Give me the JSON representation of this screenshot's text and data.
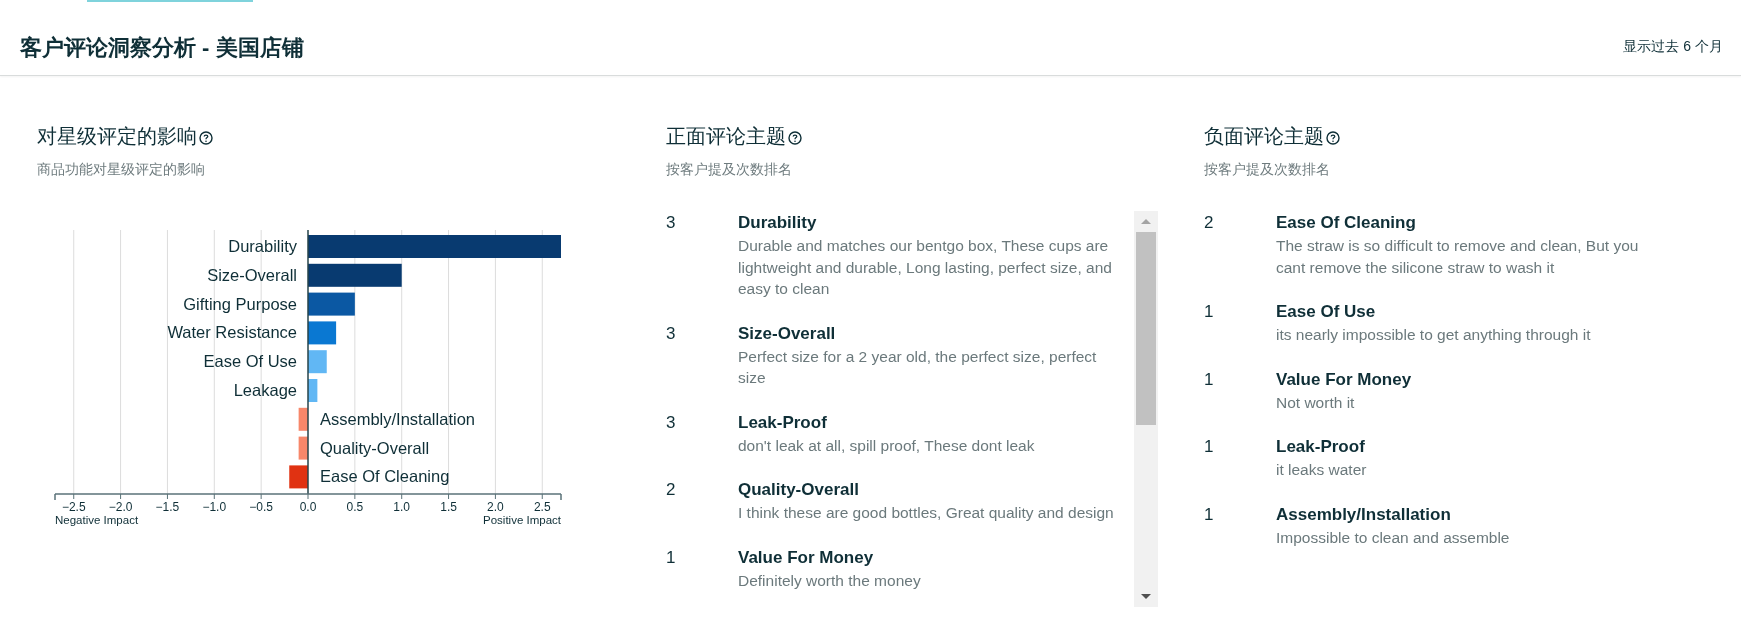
{
  "header": {
    "title": "客户评论洞察分析 - 美国店铺",
    "period": "显示过去 6 个月"
  },
  "impact": {
    "title": "对星级评定的影响",
    "subtitle": "商品功能对星级评定的影响",
    "chart_data": {
      "type": "bar",
      "orientation": "horizontal",
      "categories": [
        "Durability",
        "Size-Overall",
        "Gifting Purpose",
        "Water Resistance",
        "Ease Of Use",
        "Leakage",
        "Assembly/Installation",
        "Quality-Overall",
        "Ease Of Cleaning"
      ],
      "values": [
        2.7,
        1.0,
        0.5,
        0.3,
        0.2,
        0.1,
        -0.1,
        -0.1,
        -0.2
      ],
      "xlim": [
        -2.7,
        2.7
      ],
      "xticks": [
        {
          "value": -2.5,
          "label": "−2.5"
        },
        {
          "value": -2.0,
          "label": "−2.0"
        },
        {
          "value": -1.5,
          "label": "−1.5"
        },
        {
          "value": -1.0,
          "label": "−1.0"
        },
        {
          "value": -0.5,
          "label": "−0.5"
        },
        {
          "value": 0,
          "label": "0.0"
        },
        {
          "value": 0.5,
          "label": "0.5"
        },
        {
          "value": 1.0,
          "label": "1.0"
        },
        {
          "value": 1.5,
          "label": "1.5"
        },
        {
          "value": 2.0,
          "label": "2.0"
        },
        {
          "value": 2.5,
          "label": "2.5"
        }
      ],
      "grid": true,
      "annotations": [
        "Negative Impact",
        "Positive Impact"
      ]
    }
  },
  "positive": {
    "title": "正面评论主题",
    "subtitle": "按客户提及次数排名",
    "items": [
      {
        "count": "3",
        "topic": "Durability",
        "quote": "Durable and matches our bentgo box, These cups are lightweight and durable, Long lasting, perfect size, and easy to clean"
      },
      {
        "count": "3",
        "topic": "Size-Overall",
        "quote": "Perfect size for a 2 year old, the perfect size, perfect size"
      },
      {
        "count": "3",
        "topic": "Leak-Proof",
        "quote": "don't leak at all, spill proof, These dont leak"
      },
      {
        "count": "2",
        "topic": "Quality-Overall",
        "quote": "I think these are good bottles, Great quality and design"
      },
      {
        "count": "1",
        "topic": "Value For Money",
        "quote": "Definitely worth the money"
      }
    ]
  },
  "negative": {
    "title": "负面评论主题",
    "subtitle": "按客户提及次数排名",
    "items": [
      {
        "count": "2",
        "topic": "Ease Of Cleaning",
        "quote": "The straw is so difficult to remove and clean, But you cant remove the silicone straw to wash it"
      },
      {
        "count": "1",
        "topic": "Ease Of Use",
        "quote": "its nearly impossible to get anything through it"
      },
      {
        "count": "1",
        "topic": "Value For Money",
        "quote": "Not worth it"
      },
      {
        "count": "1",
        "topic": "Leak-Proof",
        "quote": "it leaks water"
      },
      {
        "count": "1",
        "topic": "Assembly/Installation",
        "quote": "Impossible to clean and assemble"
      }
    ]
  }
}
